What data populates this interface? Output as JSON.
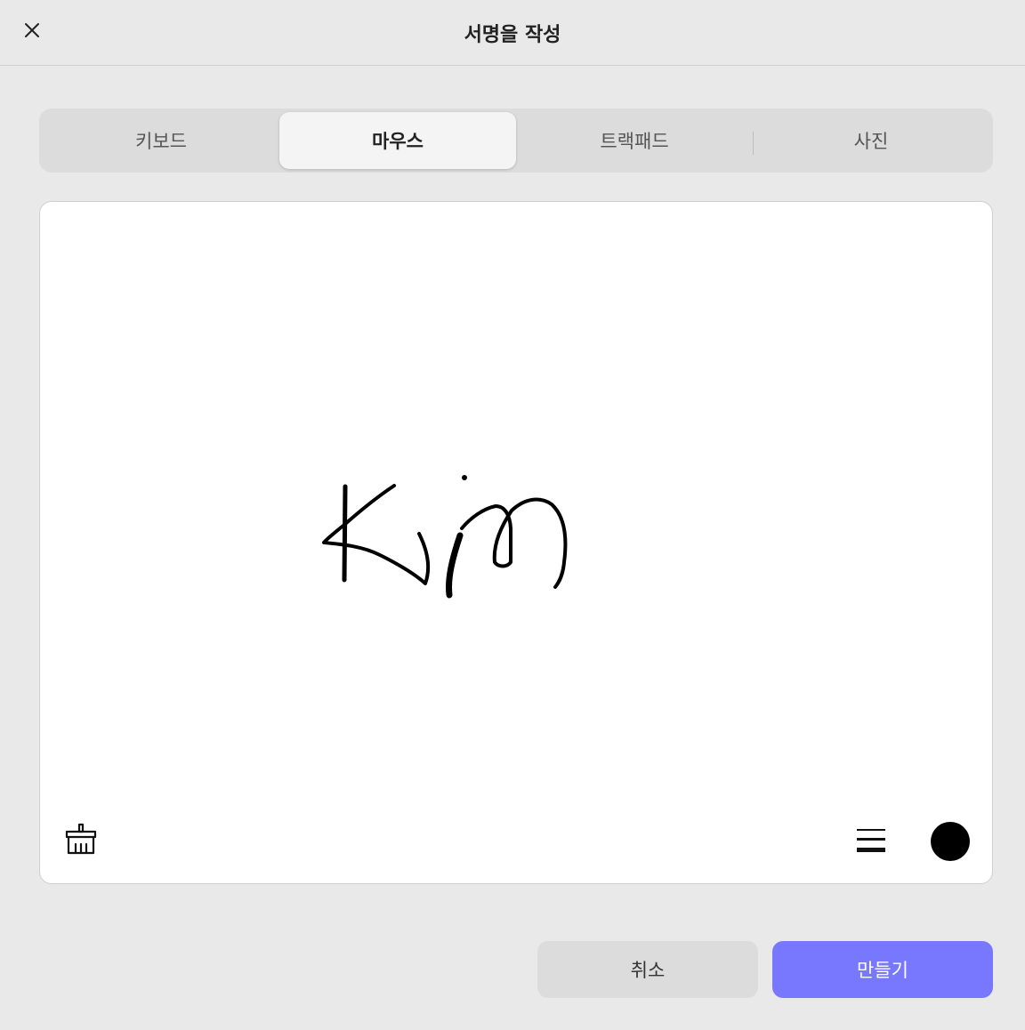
{
  "header": {
    "title": "서명을 작성",
    "close_icon": "close-icon"
  },
  "tabs": [
    {
      "label": "키보드",
      "active": false
    },
    {
      "label": "마우스",
      "active": true
    },
    {
      "label": "트랙패드",
      "active": false
    },
    {
      "label": "사진",
      "active": false
    }
  ],
  "canvas": {
    "tools": {
      "clear_icon": "brush-icon",
      "thickness_icon": "line-thickness-icon",
      "ink_color": "#000000"
    }
  },
  "actions": {
    "cancel_label": "취소",
    "create_label": "만들기",
    "create_color": "#7878ff"
  }
}
